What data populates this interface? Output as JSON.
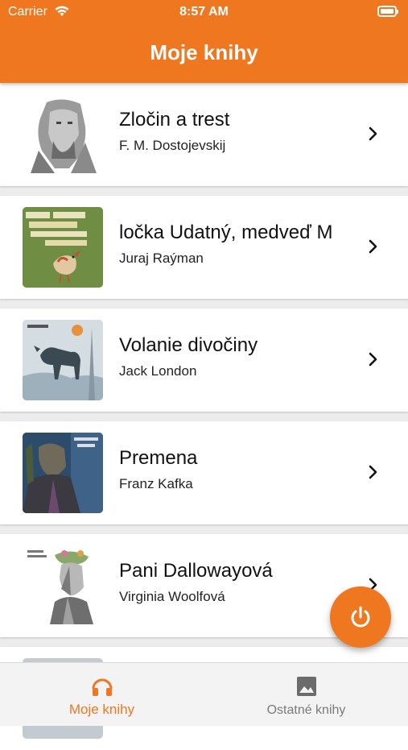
{
  "status_bar": {
    "carrier": "Carrier",
    "time": "8:57 AM"
  },
  "header": {
    "title": "Moje knihy"
  },
  "books": [
    {
      "title": "Zločin a trest",
      "author": "F. M. Dostojevskij"
    },
    {
      "title": "ločka Udatný, medveď M",
      "author": "Juraj Raýman"
    },
    {
      "title": "Volanie divočiny",
      "author": "Jack London"
    },
    {
      "title": "Premena",
      "author": "Franz Kafka"
    },
    {
      "title": "Pani Dallowayová",
      "author": "Virginia Woolfová"
    }
  ],
  "tabs": [
    {
      "label": "Moje knihy",
      "icon": "headphones-icon",
      "active": true
    },
    {
      "label": "Ostatné knihy",
      "icon": "image-icon",
      "active": false
    }
  ],
  "fab": {
    "icon": "power-icon"
  },
  "colors": {
    "accent": "#ef7720"
  }
}
